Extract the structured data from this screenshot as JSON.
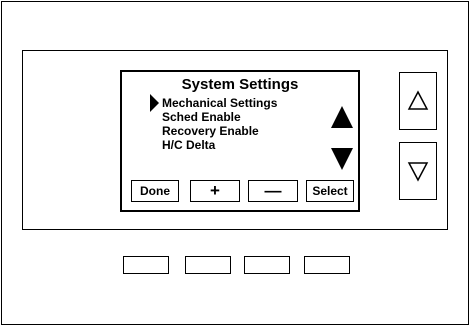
{
  "screen": {
    "title": "System Settings",
    "menu": [
      {
        "label": "Mechanical Settings",
        "selected": true
      },
      {
        "label": "Sched Enable",
        "selected": false
      },
      {
        "label": "Recovery Enable",
        "selected": false
      },
      {
        "label": "H/C Delta",
        "selected": false
      }
    ],
    "softkeys": {
      "done": "Done",
      "plus": "+",
      "minus": "—",
      "select": "Select"
    }
  },
  "icons": {
    "selection_pointer": "right-triangle-filled",
    "scroll_up": "up-triangle-filled",
    "scroll_down": "down-triangle-filled",
    "nav_up": "up-triangle-outline",
    "nav_down": "down-triangle-outline"
  },
  "colors": {
    "ink": "#000000",
    "background": "#ffffff"
  }
}
